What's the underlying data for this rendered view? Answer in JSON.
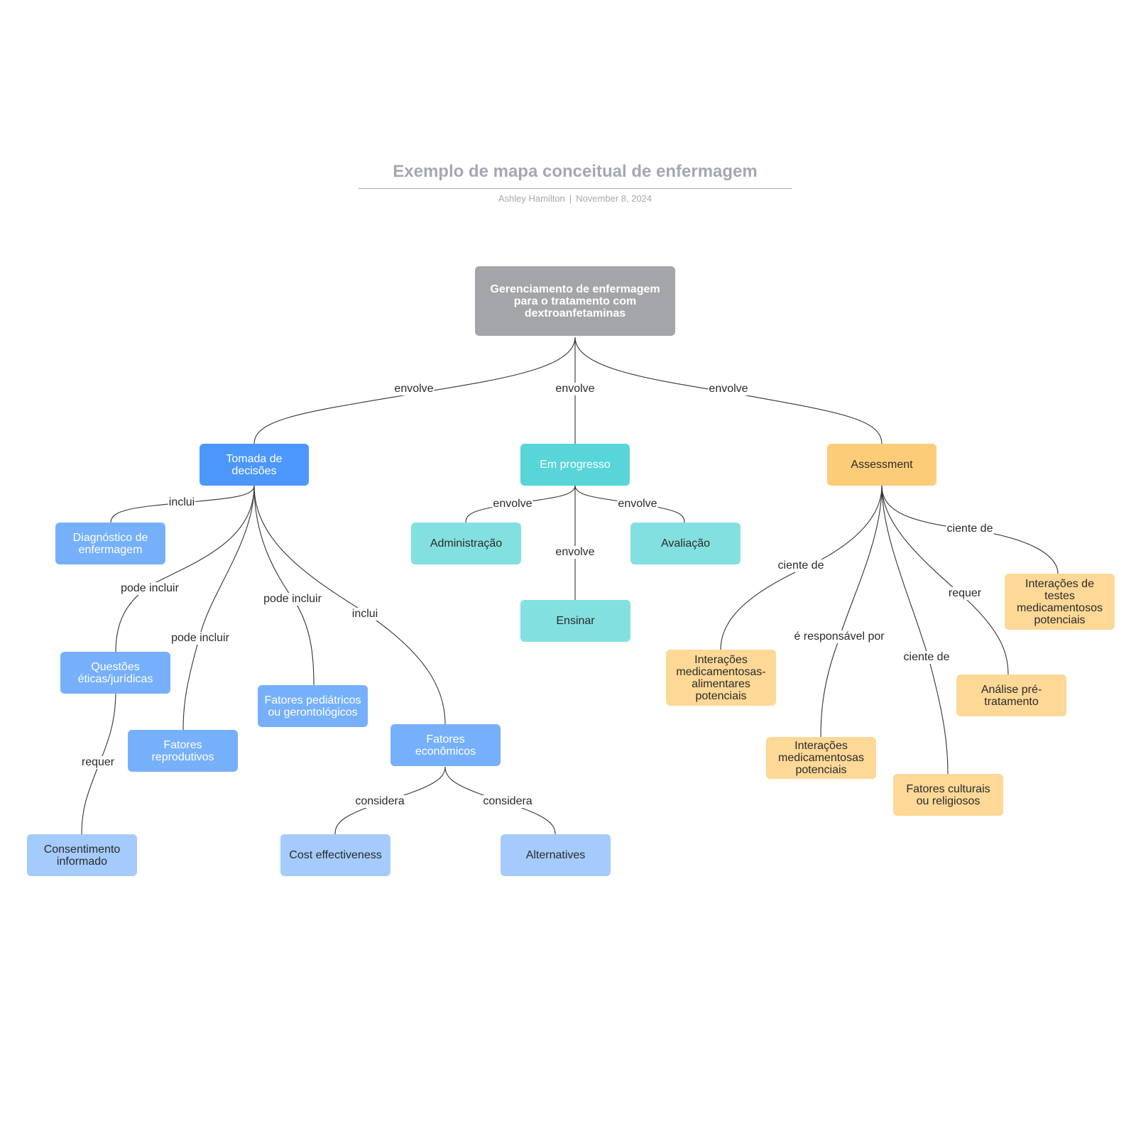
{
  "header": {
    "title": "Exemplo de mapa conceitual de enfermagem",
    "author": "Ashley Hamilton",
    "separator": "|",
    "date": "November 8, 2024"
  },
  "colors": {
    "root": "#a4a5a8",
    "blue_primary": "#4b97fb",
    "blue_secondary": "#76b0fb",
    "blue_tertiary": "#a4cbfc",
    "teal_primary": "#57d5d8",
    "teal_secondary": "#83e0e1",
    "orange_primary": "#fdcc78",
    "orange_secondary": "#fdd896",
    "edge": "#333333"
  },
  "nodes": {
    "root": "Gerenciamento de enfermagem para o tratamento com dextroanfetaminas",
    "tomada": "Tomada de decisões",
    "progresso": "Em progresso",
    "assessment": "Assessment",
    "diagnostico": "Diagnóstico de enfermagem",
    "questoes": "Questões éticas/jurídicas",
    "reprodutivos": "Fatores reprodutivos",
    "pediatricos": "Fatores pediátricos ou gerontológicos",
    "economicos": "Fatores econômicos",
    "consentimento": "Consentimento informado",
    "cost": "Cost effectiveness",
    "alternatives": "Alternatives",
    "administracao": "Administração",
    "avaliacao": "Avaliação",
    "ensinar": "Ensinar",
    "alimentares": "Interações medicamentosas-alimentares potenciais",
    "medicamentosas": "Interações medicamentosas potenciais",
    "culturais": "Fatores culturais ou religiosos",
    "analise": "Análise pré-tratamento",
    "testes": "Interações de testes medicamentosos potenciais"
  },
  "edges": [
    {
      "from": "root",
      "to": "tomada",
      "label": "envolve"
    },
    {
      "from": "root",
      "to": "progresso",
      "label": "envolve"
    },
    {
      "from": "root",
      "to": "assessment",
      "label": "envolve"
    },
    {
      "from": "tomada",
      "to": "diagnostico",
      "label": "inclui"
    },
    {
      "from": "tomada",
      "to": "questoes",
      "label": "pode incluir"
    },
    {
      "from": "tomada",
      "to": "reprodutivos",
      "label": "pode incluir"
    },
    {
      "from": "tomada",
      "to": "pediatricos",
      "label": "pode incluir"
    },
    {
      "from": "tomada",
      "to": "economicos",
      "label": "inclui"
    },
    {
      "from": "questoes",
      "to": "consentimento",
      "label": "requer"
    },
    {
      "from": "economicos",
      "to": "cost",
      "label": "considera"
    },
    {
      "from": "economicos",
      "to": "alternatives",
      "label": "considera"
    },
    {
      "from": "progresso",
      "to": "administracao",
      "label": "envolve"
    },
    {
      "from": "progresso",
      "to": "ensinar",
      "label": "envolve"
    },
    {
      "from": "progresso",
      "to": "avaliacao",
      "label": "envolve"
    },
    {
      "from": "assessment",
      "to": "alimentares",
      "label": "ciente de"
    },
    {
      "from": "assessment",
      "to": "medicamentosas",
      "label": "é responsável por"
    },
    {
      "from": "assessment",
      "to": "culturais",
      "label": "ciente de"
    },
    {
      "from": "assessment",
      "to": "analise",
      "label": "requer"
    },
    {
      "from": "assessment",
      "to": "testes",
      "label": "ciente de"
    }
  ]
}
